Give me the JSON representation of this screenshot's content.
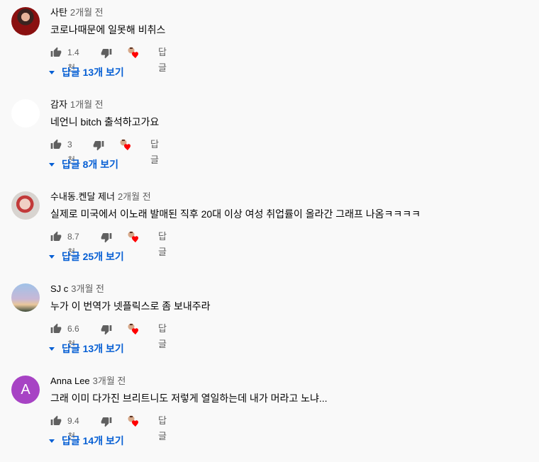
{
  "comments": [
    {
      "author": "사탄",
      "time": "2개월 전",
      "text": "코로나때문에 일못해 비취스",
      "likes": "1.4천",
      "reply_label": "답글",
      "replies": "답글 13개 보기"
    },
    {
      "author": "감자",
      "time": "1개월 전",
      "text": "네언니 bitch 출석하고가요",
      "likes": "3천",
      "reply_label": "답글",
      "replies": "답글 8개 보기"
    },
    {
      "author": "수내동.켄달 제너",
      "time": "2개월 전",
      "text": "실제로 미국에서 이노래 발매된 직후  20대 이상 여성 취업률이 올라간 그래프 나옴ㅋㅋㅋㅋ",
      "likes": "8.7천",
      "reply_label": "답글",
      "replies": "답글 25개 보기"
    },
    {
      "author": "SJ c",
      "time": "3개월 전",
      "text": "누가 이 번역가 넷플릭스로 좀 보내주라",
      "likes": "6.6천",
      "reply_label": "답글",
      "replies": "답글 13개 보기"
    },
    {
      "author": "Anna Lee",
      "avatar_letter": "A",
      "time": "3개월 전",
      "text": "그래 이미 다가진 브리트니도 저렇게 열일하는데 내가 머라고 노냐...",
      "likes": "9.4천",
      "reply_label": "답글",
      "replies": "답글 14개 보기"
    }
  ],
  "colors": {
    "background": "#f9f9f9",
    "link": "#065fd4",
    "secondary_text": "#606060",
    "heart": "#ff0000"
  }
}
